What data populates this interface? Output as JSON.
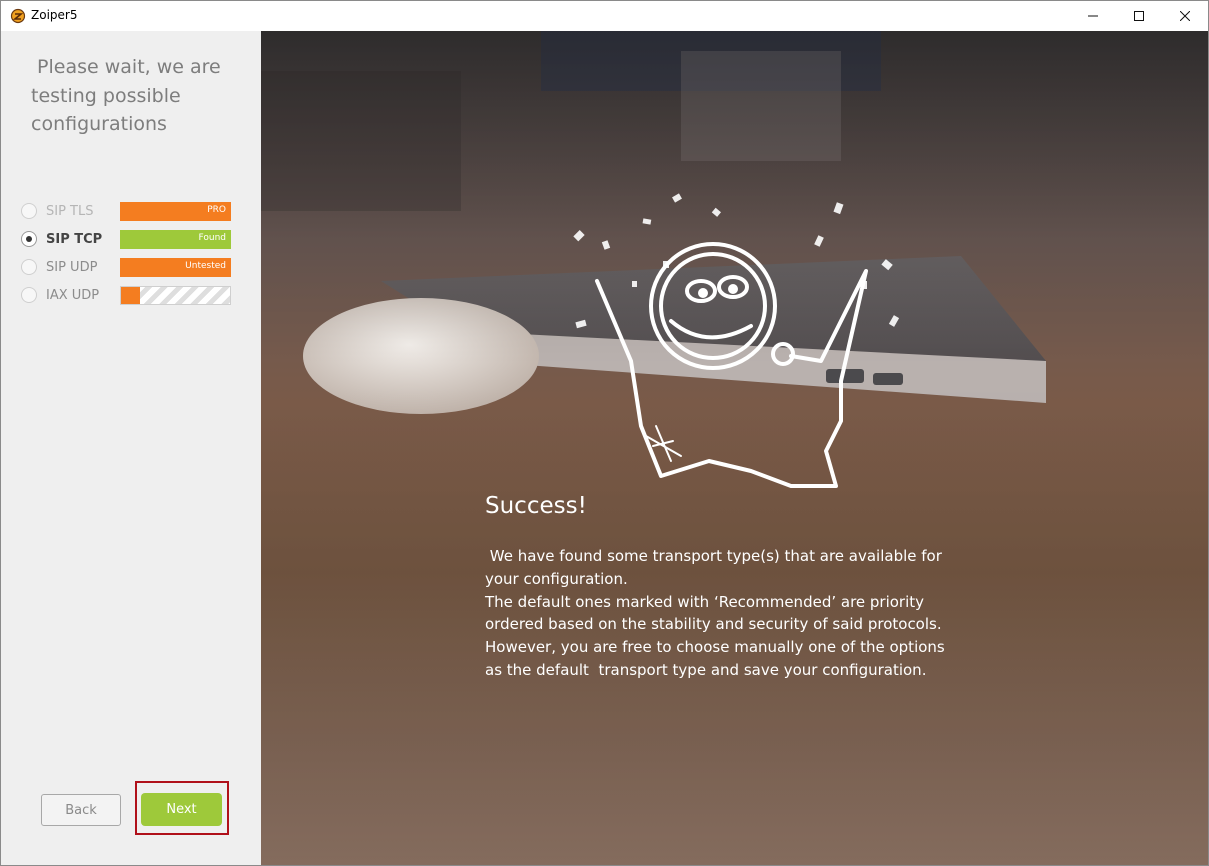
{
  "window": {
    "title": "Zoiper5"
  },
  "sidebar": {
    "heading": " Please wait, we are\ntesting possible\nconfigurations",
    "transports": [
      {
        "label": "SIP TLS",
        "status": "PRO",
        "state": "disabled"
      },
      {
        "label": "SIP TCP",
        "status": "Found",
        "state": "selected"
      },
      {
        "label": "SIP UDP",
        "status": "Untested",
        "state": "normal"
      },
      {
        "label": "IAX UDP",
        "status": "",
        "state": "testing",
        "progress": 0.17
      }
    ],
    "back_label": "Back",
    "next_label": "Next"
  },
  "main": {
    "title": "Success!",
    "paragraphs": [
      " We have found some transport type(s) that are available for your configuration.",
      "The default ones marked with ‘Recommended’ are priority ordered based on the stability and security of said protocols.",
      "However, you are free to choose manually one of the options as the default  transport type and save your configuration."
    ]
  },
  "colors": {
    "accent_green": "#9ec93a",
    "accent_orange": "#f47d20",
    "highlight_red": "#b0101a"
  },
  "icons": [
    "zoiper-logo-icon",
    "minimize-icon",
    "maximize-icon",
    "close-icon",
    "celebration-mascot-icon"
  ]
}
